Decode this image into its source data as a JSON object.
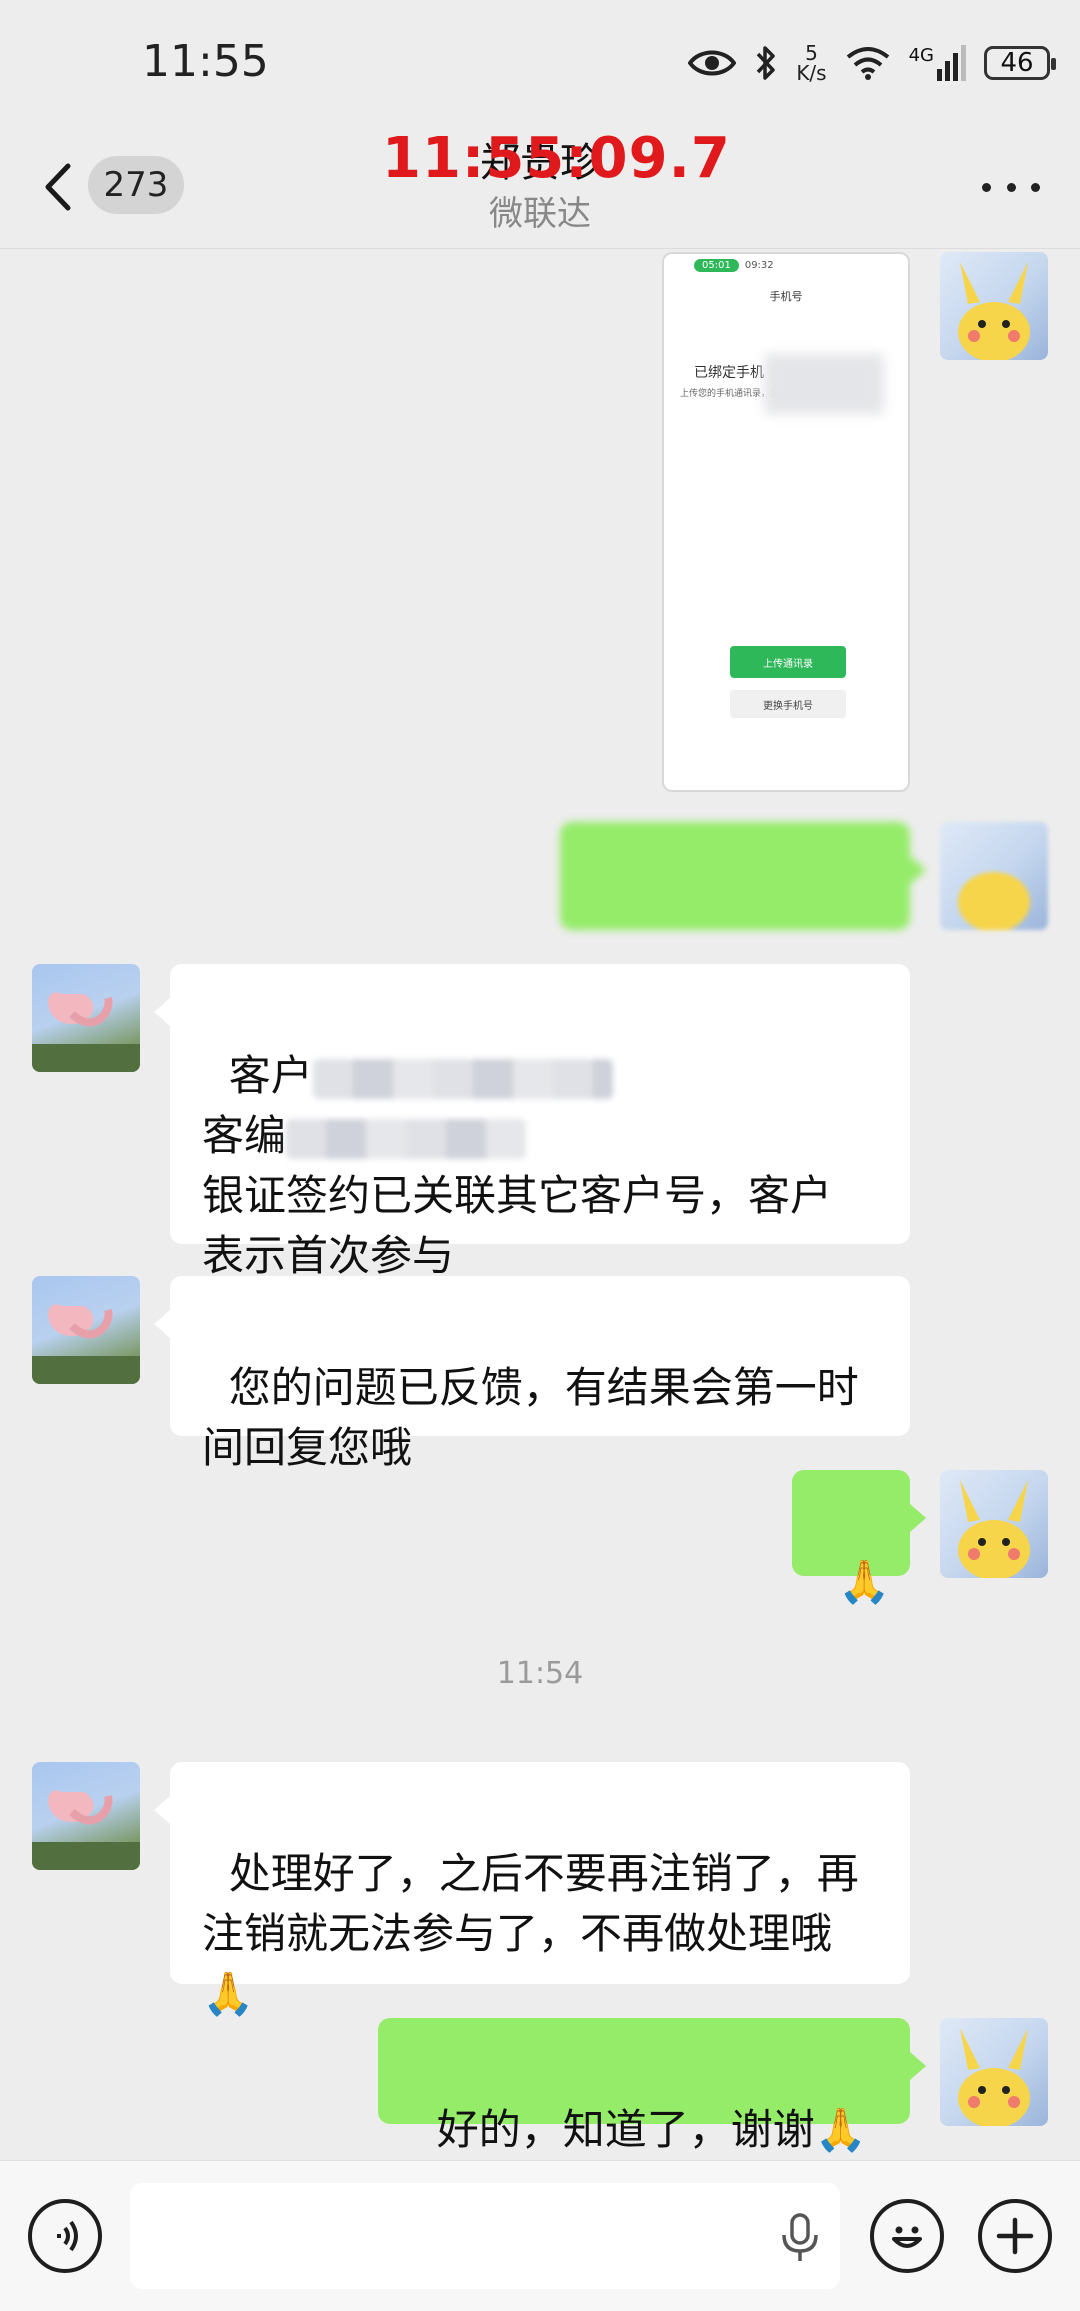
{
  "status_bar": {
    "time": "11:55",
    "speed_value": "5",
    "speed_unit": "K/s",
    "network": "4G",
    "battery": "46"
  },
  "header": {
    "back_count": "273",
    "title": "郑贵珍",
    "subtitle": "微联达",
    "overlay_clock": "11:55:09.7"
  },
  "image_message": {
    "call_duration": "05:01",
    "phone_time": "09:32",
    "nav_title": "手机号",
    "bound_label": "已绑定手机",
    "hint": "上传您的手机通讯录，注册手机号。",
    "upload_button": "上传通讯录",
    "change_button": "更换手机号"
  },
  "messages": [
    {
      "line1_prefix": "客户",
      "line2_prefix": "客编",
      "line3": "银证签约已关联其它客户号，客户\n表示首次参与"
    },
    {
      "text": "您的问题已反馈，有结果会第一时\n间回复您哦"
    },
    {
      "emoji": "🙏"
    },
    {
      "text": "处理好了，之后不要再注销了，再\n注销就无法参与了，不再做处理哦\n🙏"
    },
    {
      "text": "好的，知道了，谢谢🙏"
    }
  ],
  "divider_time": "11:54",
  "input_bar": {
    "voice_icon": "voice-toggle-icon",
    "mic_icon": "microphone-icon",
    "emoji_icon": "emoji-icon",
    "add_icon": "plus-icon"
  }
}
